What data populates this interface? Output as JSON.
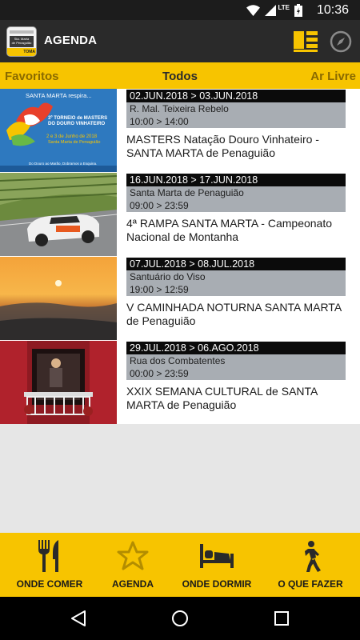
{
  "status_bar": {
    "time": "10:36",
    "network": "LTE"
  },
  "app_bar": {
    "title": "AGENDA",
    "logo_lines": [
      "Sta. Marta",
      "de Penaguião"
    ],
    "logo_band": "TOMA",
    "list_icon": "list-view-icon",
    "compass_icon": "compass-icon"
  },
  "tabs": {
    "left": "Favoritos",
    "center": "Todos",
    "right": "Ar Livre"
  },
  "events": [
    {
      "date": "02.JUN.2018 > 03.JUN.2018",
      "location": "R. Mal. Teixeira Rebelo",
      "time": "10:00 > 14:00",
      "name": "MASTERS Natação Douro Vinhateiro - SANTA MARTA de Penaguião",
      "poster": {
        "line1": "SANTA MARTA respira...",
        "line2": "3º TORNEIO de MASTERS",
        "line3": "DO DOURO VINHATEIRO",
        "line4": "2 e 3 de Junho de 2018",
        "line5": "Santa Marta de Penaguião",
        "footer": "Do Douro ao Marão, Dobramos a Esquina."
      }
    },
    {
      "date": "16.JUN.2018 > 17.JUN.2018",
      "location": "Santa Marta de Penaguião",
      "time": "09:00 > 23:59",
      "name": "4ª RAMPA SANTA MARTA - Campeonato Nacional de Montanha"
    },
    {
      "date": "07.JUL.2018 > 08.JUL.2018",
      "location": "Santuário do Viso",
      "time": "19:00 > 12:59",
      "name": "V CAMINHADA NOTURNA SANTA MARTA de Penaguião"
    },
    {
      "date": "29.JUL.2018 > 06.AGO.2018",
      "location": "Rua dos Combatentes",
      "time": "00:00 > 23:59",
      "name": "XXIX SEMANA CULTURAL de SANTA MARTA de Penaguião"
    }
  ],
  "bottom_nav": [
    {
      "label": "ONDE COMER",
      "icon": "fork-knife-icon"
    },
    {
      "label": "AGENDA",
      "icon": "star-icon"
    },
    {
      "label": "ONDE DORMIR",
      "icon": "bed-icon"
    },
    {
      "label": "O QUE FAZER",
      "icon": "hiker-icon"
    }
  ],
  "colors": {
    "accent": "#f7c400",
    "app_bar": "#2a2a2a",
    "info_band": "#a8adb3",
    "date_band": "#0b0b0b"
  }
}
